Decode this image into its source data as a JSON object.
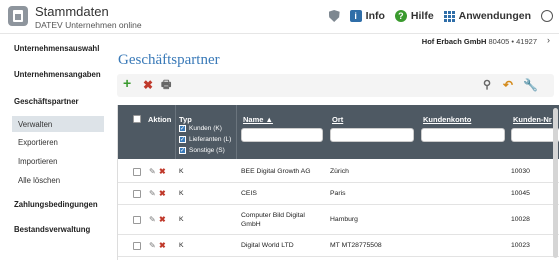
{
  "header": {
    "app_title": "Stammdaten",
    "app_subtitle": "DATEV Unternehmen online",
    "info_label": "Info",
    "help_label": "Hilfe",
    "apps_label": "Anwendungen"
  },
  "sidebar": {
    "items": [
      {
        "label": "Unternehmensauswahl"
      },
      {
        "label": "Unternehmensangaben"
      },
      {
        "label": "Geschäftspartner"
      },
      {
        "label": "Verwalten"
      },
      {
        "label": "Exportieren"
      },
      {
        "label": "Importieren"
      },
      {
        "label": "Alle löschen"
      },
      {
        "label": "Zahlungsbedingungen"
      },
      {
        "label": "Bestandsverwaltung"
      }
    ]
  },
  "company": {
    "name": "Hof Erbach GmbH",
    "numbers": "80405 • 41927"
  },
  "main": {
    "title": "Geschäftspartner"
  },
  "table": {
    "columns": {
      "aktion": "Aktion",
      "typ": "Typ",
      "name": "Name ▲",
      "ort": "Ort",
      "konto": "Kundenkonto",
      "nr": "Kunden-Nr"
    },
    "typ_options": [
      "Kunden (K)",
      "Lieferanten (L)",
      "Sonstige (S)"
    ],
    "rows": [
      {
        "typ": "K",
        "name": "BEE Digital Growth AG",
        "ort": "Zürich",
        "nr": "10030"
      },
      {
        "typ": "K",
        "name": "CEIS",
        "ort": "Paris",
        "nr": "10045"
      },
      {
        "typ": "K",
        "name": "Computer Bild Digital GmbH",
        "ort": "Hamburg",
        "nr": "10028"
      },
      {
        "typ": "K",
        "name": "Digital World LTD",
        "ort": "MT MT28775508",
        "nr": "10023"
      }
    ]
  },
  "colors": {
    "accent": "#3a7ab8",
    "header_bg": "#4e5963",
    "delete_red": "#c0392b",
    "add_green": "#3a9a2e"
  }
}
